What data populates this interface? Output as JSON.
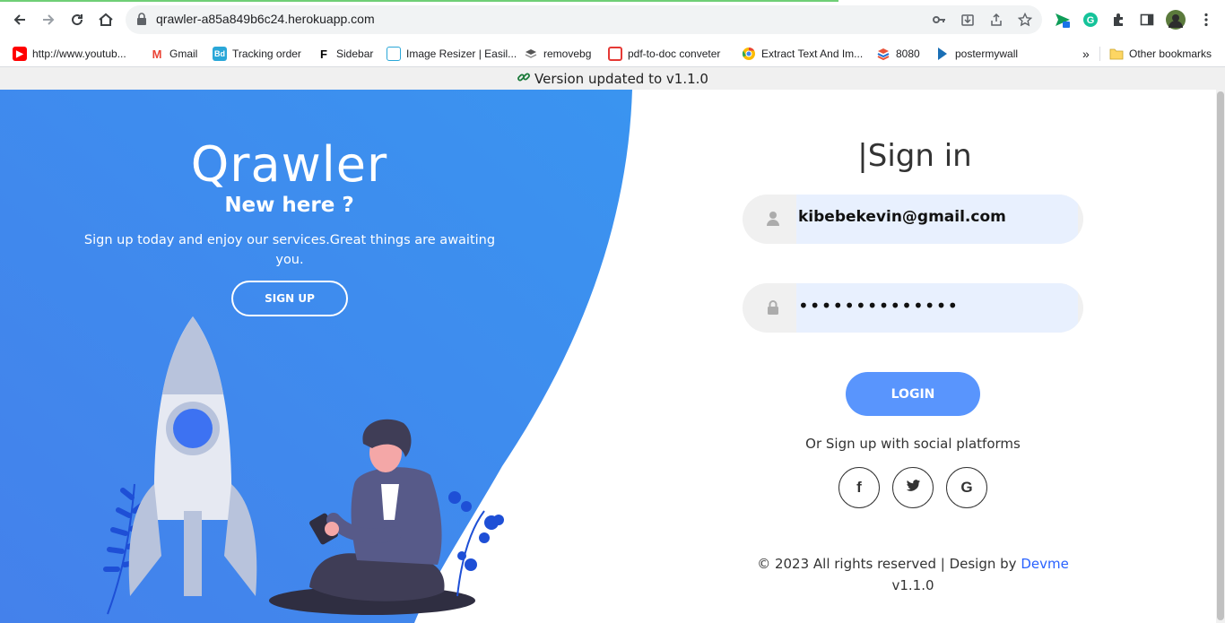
{
  "browser": {
    "url": "qrawler-a85a849b6c24.herokuapp.com",
    "bookmarks": [
      {
        "label": "http://www.youtub...",
        "icon": "youtube-icon"
      },
      {
        "label": "Gmail",
        "icon": "gmail-icon"
      },
      {
        "label": "Tracking order",
        "icon": "tracking-icon"
      },
      {
        "label": "Sidebar",
        "icon": "sidebar-icon"
      },
      {
        "label": "Image Resizer | Easil...",
        "icon": "image-resizer-icon"
      },
      {
        "label": "removebg",
        "icon": "removebg-icon"
      },
      {
        "label": "pdf-to-doc conveter",
        "icon": "pdf-icon"
      },
      {
        "label": "Extract Text And Im...",
        "icon": "chrome-icon"
      },
      {
        "label": "8080",
        "icon": "stack-icon"
      },
      {
        "label": "postermywall",
        "icon": "postermywall-icon"
      }
    ],
    "overflow": "»",
    "other_bookmarks": "Other bookmarks"
  },
  "banner": {
    "text": "Version updated to v1.1.0"
  },
  "left_panel": {
    "brand": "Qrawler",
    "subtitle": "New here ?",
    "description": "Sign up today and enjoy our services.Great things are awaiting you.",
    "signup_label": "SIGN UP"
  },
  "signin": {
    "title": "|Sign in",
    "email_value": "kibebekevin@gmail.com",
    "password_mask": "••••••••••••••",
    "login_label": "LOGIN",
    "social_text": "Or Sign up with social platforms",
    "socials": [
      "f",
      "t",
      "G"
    ]
  },
  "footer": {
    "copyright": "© 2023 All rights reserved | Design by ",
    "designer": "Devme",
    "version": "v1.1.0"
  },
  "colors": {
    "primary_gradient_start": "#4481eb",
    "primary_gradient_end": "#04befe",
    "login_button": "#5995fd",
    "input_bg": "#f0f0f0",
    "autofill_bg": "#e8f0fe",
    "link": "#2962ff"
  }
}
